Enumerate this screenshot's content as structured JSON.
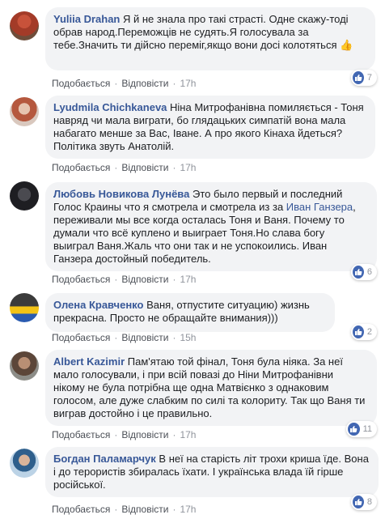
{
  "labels": {
    "like": "Подобається",
    "reply": "Відповісти",
    "sep": "·"
  },
  "comments": [
    {
      "author": "Yuliia Drahan",
      "text": "Я й не знала про такі страсті. Одне скажу-тоді обрав народ.Переможців не судять.Я голосувала за тебе.Значить ти дійсно переміг,якщо вони досі колотяться",
      "emoji": "👍",
      "time": "17h",
      "reactions": "7"
    },
    {
      "author": "Lyudmila Chichkaneva",
      "text": "Ніна Митрофанівна помиляється - Тоня навряд чи мала виграти, бо глядацьких симпатій вона мала набагато менше за Вас, Іване. А про якого Кінаха йдеться? Політика звуть Анатолій.",
      "time": "17h",
      "reactions": ""
    },
    {
      "author": "Любовь Новикова Лунёва",
      "text_before": "Это было первый и последний Голос Краины что я смотрела и смотрела из за",
      "mention": "Иван Ганзера",
      "text_after": ", переживали мы все когда осталась Тоня и Ваня. Почему то думали что всё куплено и выиграет Тоня.Но слава богу выиграл Ваня.Жаль что они так и не успокоились. Иван Ганзера достойный победитель.",
      "time": "17h",
      "reactions": "6"
    },
    {
      "author": "Олена Кравченко",
      "text": "Ваня, отпустите ситуацию) жизнь прекрасна. Просто не обращайте внимания)))",
      "time": "15h",
      "reactions": "2"
    },
    {
      "author": "Albert Kazimir",
      "text": "Пам'ятаю той фінал, Тоня була ніяка. За неї мало голосували, і при всій повазі до Ніни Митрофанівни нікому не була потрібна ще одна Матвієнко з однаковим голосом, але дуже слабким по силі та колориту. Так що Ваня ти виграв достойно і це правильно.",
      "time": "17h",
      "reactions": "11"
    },
    {
      "author": "Богдан Паламарчук",
      "text": "В неї на старість літ трохи криша їде. Вона і до терористів збиралась їхати. І українська влада їй гірше російської.",
      "time": "17h",
      "reactions": "8"
    }
  ]
}
